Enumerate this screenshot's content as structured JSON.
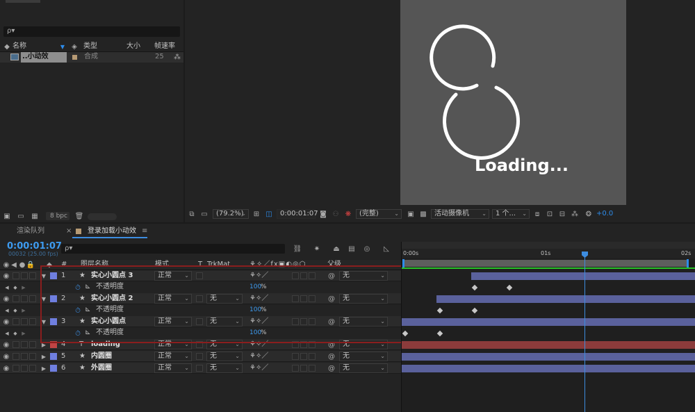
{
  "project": {
    "search_placeholder": "ρ▾",
    "columns": {
      "name": "名称",
      "type": "类型",
      "size": "大小",
      "fps": "帧速率"
    },
    "item": {
      "name": "..小动效",
      "type": "合成",
      "fps": "25"
    },
    "bpc": "8 bpc"
  },
  "viewer": {
    "loading_text": "Loading...",
    "zoom": "(79.2%)",
    "timecode": "0:00:01:07",
    "quality": "(完整)",
    "camera": "活动摄像机",
    "views": "1 个...",
    "exposure": "+0.0"
  },
  "tabs": {
    "render_queue": "渲染队列",
    "comp": "登录加载小动效"
  },
  "timeline": {
    "timecode": "0:00:01:07",
    "frame_info": "00032 (25.00 fps)",
    "search_placeholder": "ρ▾",
    "headers": {
      "layer_name": "图层名称",
      "mode": "模式",
      "trkmat": "TrkMat",
      "parent": "父级"
    },
    "ruler": {
      "t0": "0:00s",
      "t1": "01s",
      "t2": "02s"
    },
    "opacity_label": "不透明度",
    "opacity_value": "100",
    "percent": "%",
    "layers": [
      {
        "num": "1",
        "name": "实心小圆点 3",
        "mode": "正常",
        "trkmat": "",
        "parent": "无",
        "color": "#6f7fe0"
      },
      {
        "num": "2",
        "name": "实心小圆点 2",
        "mode": "正常",
        "trkmat": "无",
        "parent": "无",
        "color": "#6f7fe0"
      },
      {
        "num": "3",
        "name": "实心小圆点",
        "mode": "正常",
        "trkmat": "无",
        "parent": "无",
        "color": "#6f7fe0"
      },
      {
        "num": "4",
        "name": "loading",
        "mode": "正常",
        "trkmat": "无",
        "parent": "无",
        "color": "#c04444"
      },
      {
        "num": "5",
        "name": "内圆圈",
        "mode": "正常",
        "trkmat": "无",
        "parent": "无",
        "color": "#6f7fe0"
      },
      {
        "num": "6",
        "name": "外圆圈",
        "mode": "正常",
        "trkmat": "无",
        "parent": "无",
        "color": "#6f7fe0"
      }
    ]
  },
  "colors": {
    "accent": "#2d8ceb",
    "layer_bar": "#5a619c",
    "text_bar": "#8b3b3b",
    "highlight": "#8b1e1e"
  }
}
